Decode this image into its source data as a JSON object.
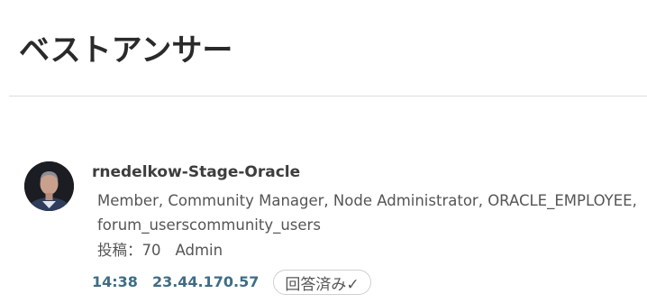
{
  "page": {
    "title": "ベストアンサー"
  },
  "post": {
    "author": "rnedelkow-Stage-Oracle",
    "roles": "Member, Community Manager, Node Administrator, ORACLE_EMPLOYEE, forum_userscommunity_users",
    "posts_label": "投稿：70",
    "rank": "Admin",
    "time": "14:38",
    "ip": "23.44.170.57",
    "answered_label": "回答済み✓"
  },
  "colors": {
    "link": "#3f6d84",
    "title": "#2a2a2a",
    "muted_text": "#555555",
    "divider": "#dddddd"
  },
  "icons": {
    "avatar": "user-avatar-photo"
  }
}
